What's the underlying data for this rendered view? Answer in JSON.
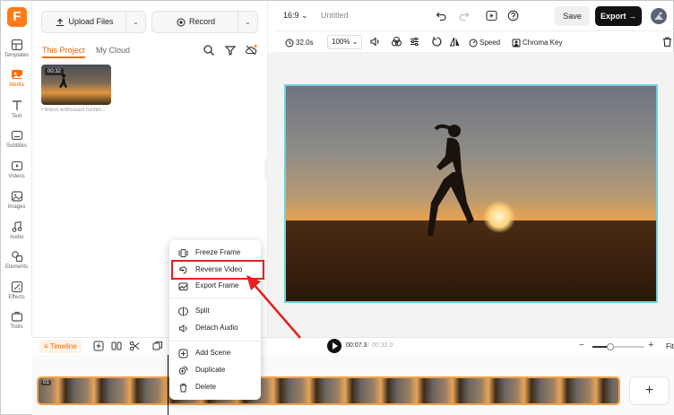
{
  "app": {
    "logo_letter": "F"
  },
  "sidebar": {
    "items": [
      {
        "label": "Templates"
      },
      {
        "label": "Media"
      },
      {
        "label": "Text"
      },
      {
        "label": "Subtitles"
      },
      {
        "label": "Videos"
      },
      {
        "label": "Images"
      },
      {
        "label": "Audio"
      },
      {
        "label": "Elements"
      },
      {
        "label": "Effects"
      },
      {
        "label": "Tools"
      }
    ],
    "active": "Media"
  },
  "media_panel": {
    "upload_label": "Upload Files",
    "record_label": "Record",
    "tabs": [
      {
        "label": "This Project"
      },
      {
        "label": "My Cloud"
      }
    ],
    "clip": {
      "duration": "00:32",
      "name": "Fitness enthusiast runnin..."
    }
  },
  "topbar": {
    "aspect_ratio": "16:9",
    "doc_title": "Untitled",
    "save_label": "Save",
    "export_label": "Export"
  },
  "toolbar": {
    "duration": "32.0s",
    "zoom": "100%",
    "speed_label": "Speed",
    "chroma_label": "Chroma Key"
  },
  "timeline": {
    "tab_label": "Timeline",
    "current_time": "00:07.3",
    "separator": "/",
    "total_time": "00:32.0",
    "fit_label": "Fit",
    "zoom_level": 0.35,
    "track_index": "01"
  },
  "context_menu": {
    "items": [
      {
        "label": "Freeze Frame",
        "icon": "freeze-frame-icon"
      },
      {
        "label": "Reverse Video",
        "icon": "reverse-video-icon",
        "highlighted": true
      },
      {
        "label": "Export Frame",
        "icon": "export-frame-icon"
      },
      {
        "label": "Split",
        "icon": "split-icon"
      },
      {
        "label": "Detach Audio",
        "icon": "detach-audio-icon"
      },
      {
        "label": "Add Scene",
        "icon": "add-scene-icon"
      },
      {
        "label": "Duplicate",
        "icon": "duplicate-icon"
      },
      {
        "label": "Delete",
        "icon": "delete-icon"
      }
    ]
  },
  "colors": {
    "accent": "#ff6a00",
    "highlight_box": "#e52020",
    "selection_border": "#6ed3df",
    "track_border": "#f5a14a"
  }
}
